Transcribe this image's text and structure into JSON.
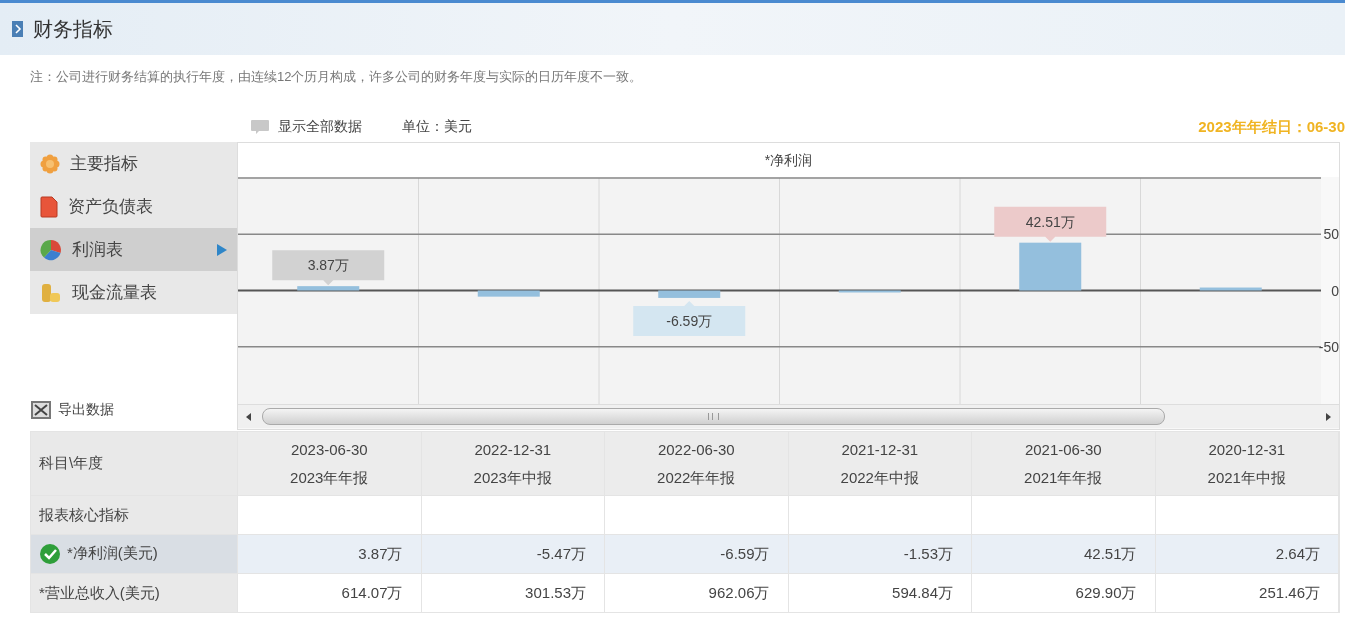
{
  "header": {
    "title": "财务指标"
  },
  "note": "注：公司进行财务结算的执行年度，由连续12个历月构成，许多公司的财务年度与实际的日历年度不一致。",
  "toolbar": {
    "show_all": "显示全部数据",
    "unit": "单位：美元",
    "year_end": "2023年年结日：06-30"
  },
  "nav": {
    "items": [
      {
        "label": "主要指标",
        "kind": "flower",
        "selected": false
      },
      {
        "label": "资产负债表",
        "kind": "document",
        "selected": false
      },
      {
        "label": "利润表",
        "kind": "pie",
        "selected": true
      },
      {
        "label": "现金流量表",
        "kind": "coins",
        "selected": false
      }
    ]
  },
  "export": {
    "label": "导出数据"
  },
  "chart": {
    "chart_data": {
      "type": "bar",
      "title": "*净利润",
      "series": [
        {
          "color": "#94bfdd",
          "values": [
            3.87,
            -5.47,
            -6.59,
            -1.53,
            42.51,
            2.64
          ]
        }
      ],
      "ylim": [
        -100,
        100
      ],
      "yticks": [
        -50,
        0,
        50
      ],
      "annotations": [
        {
          "y": 3.87,
          "text": "3.87万"
        },
        {
          "y": -6.59,
          "text": "-6.59万"
        },
        {
          "y": 42.51,
          "text": "42.51万"
        }
      ]
    }
  },
  "table": {
    "corner": "科目\\年度",
    "columns": [
      {
        "date": "2023-06-30",
        "report": "2023年年报"
      },
      {
        "date": "2022-12-31",
        "report": "2023年中报"
      },
      {
        "date": "2022-06-30",
        "report": "2022年年报"
      },
      {
        "date": "2021-12-31",
        "report": "2022年中报"
      },
      {
        "date": "2021-06-30",
        "report": "2021年年报"
      },
      {
        "date": "2020-12-31",
        "report": "2021年中报"
      }
    ],
    "rows": [
      {
        "kind": "section",
        "label": "报表核心指标",
        "selected": false
      },
      {
        "kind": "data",
        "label": "*净利润(美元)",
        "selected": true,
        "cells": [
          "3.87万",
          "-5.47万",
          "-6.59万",
          "-1.53万",
          "42.51万",
          "2.64万"
        ]
      },
      {
        "kind": "data",
        "label": "*营业总收入(美元)",
        "selected": false,
        "cells": [
          "614.07万",
          "301.53万",
          "962.06万",
          "594.84万",
          "629.90万",
          "251.46万"
        ]
      }
    ]
  }
}
